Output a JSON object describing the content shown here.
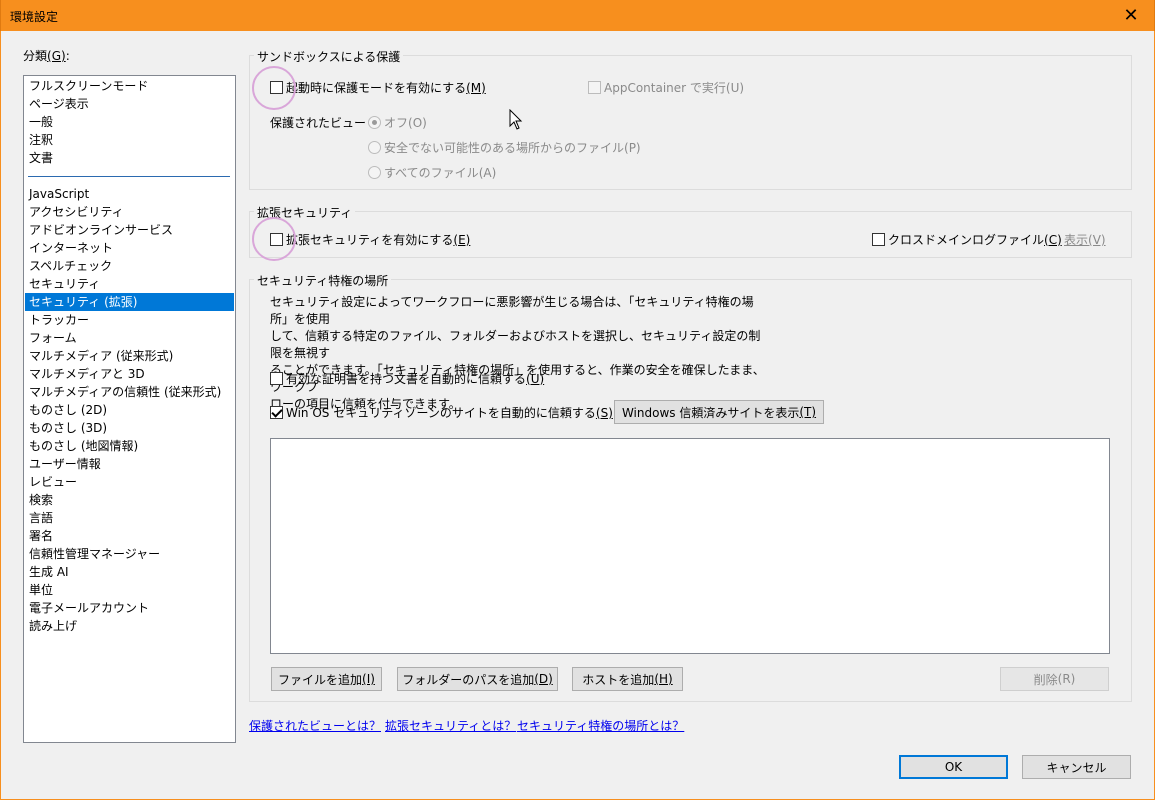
{
  "window": {
    "title": "環境設定",
    "close_glyph": "✕"
  },
  "category": {
    "label": "分類",
    "mnemonic": "(G)",
    "colon": ":",
    "items_top": [
      "フルスクリーンモード",
      "ページ表示",
      "一般",
      "注釈",
      "文書"
    ],
    "items": [
      "JavaScript",
      "アクセシビリティ",
      "アドビオンラインサービス",
      "インターネット",
      "スペルチェック",
      "セキュリティ",
      "セキュリティ (拡張)",
      "トラッカー",
      "フォーム",
      "マルチメディア (従来形式)",
      "マルチメディアと 3D",
      "マルチメディアの信頼性 (従来形式)",
      "ものさし (2D)",
      "ものさし (3D)",
      "ものさし (地図情報)",
      "ユーザー情報",
      "レビュー",
      "検索",
      "言語",
      "署名",
      "信頼性管理マネージャー",
      "生成 AI",
      "単位",
      "電子メールアカウント",
      "読み上げ"
    ],
    "selected": "セキュリティ (拡張)"
  },
  "sandbox": {
    "title": "サンドボックスによる保護",
    "protected_mode": {
      "label": "起動時に保護モードを有効にする",
      "mnemonic": "(M)",
      "checked": false
    },
    "app_container": {
      "label": "AppContainer で実行",
      "mnemonic": "(U)",
      "checked": false
    },
    "protected_view_label": "保護されたビュー",
    "protected_view_options": [
      {
        "label": "オフ",
        "mnemonic": "(O)",
        "selected": true
      },
      {
        "label": "安全でない可能性のある場所からのファイル",
        "mnemonic": "(P)",
        "selected": false
      },
      {
        "label": "すべてのファイル",
        "mnemonic": "(A)",
        "selected": false
      }
    ]
  },
  "enhanced": {
    "title": "拡張セキュリティ",
    "enable": {
      "label": "拡張セキュリティを有効にする",
      "mnemonic": "(E)",
      "checked": false
    },
    "cross_domain": {
      "label": "クロスドメインログファイル",
      "mnemonic": "(C)",
      "checked": false
    },
    "view_link": {
      "label": "表示",
      "mnemonic": "(V)"
    }
  },
  "privileged": {
    "title": "セキュリティ特権の場所",
    "description": [
      "セキュリティ設定によってワークフローに悪影響が生じる場合は、「セキュリティ特権の場所」を使用",
      "して、信頼する特定のファイル、フォルダーおよびホストを選択し、セキュリティ設定の制限を無視す",
      "ることができます。「セキュリティ特権の場所」を使用すると、作業の安全を確保したまま、ワークフ",
      "ローの項目に信頼を付与できます。"
    ],
    "trust_certified": {
      "label": "有効な証明書を持つ文書を自動的に信頼する",
      "mnemonic": "(U)",
      "checked": false
    },
    "trust_win_os": {
      "label": "Win OS セキュリティゾーンのサイトを自動的に信頼する",
      "mnemonic": "(S)",
      "checked": true
    },
    "show_trusted_sites": {
      "label": "Windows 信頼済みサイトを表示",
      "mnemonic": "(T)"
    },
    "add_file": {
      "label": "ファイルを追加",
      "mnemonic": "(I)"
    },
    "add_folder": {
      "label": "フォルダーのパスを追加",
      "mnemonic": "(D)"
    },
    "add_host": {
      "label": "ホストを追加",
      "mnemonic": "(H)"
    },
    "delete": {
      "label": "削除",
      "mnemonic": "(R)"
    }
  },
  "help_links": {
    "protected_view": "保護されたビューとは？",
    "enhanced": "拡張セキュリティとは？",
    "privileged": "セキュリティ特権の場所とは？"
  },
  "footer": {
    "ok": "OK",
    "cancel": "キャンセル"
  }
}
